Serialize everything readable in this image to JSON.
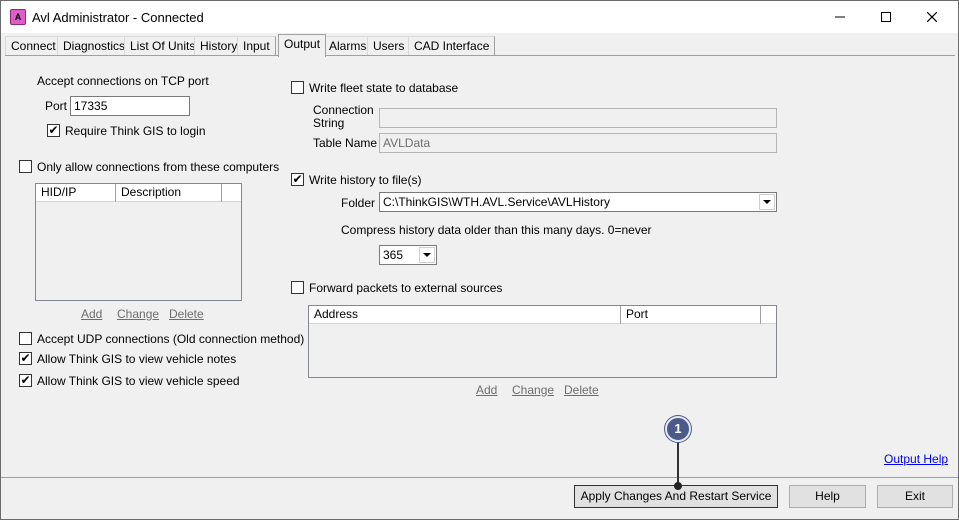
{
  "window": {
    "title": "Avl Administrator - Connected",
    "icon": "app-icon",
    "icon_text": "A"
  },
  "tabs": [
    {
      "label": "Connect"
    },
    {
      "label": "Diagnostics"
    },
    {
      "label": "List Of Units"
    },
    {
      "label": "History"
    },
    {
      "label": "Input"
    },
    {
      "label": "Output",
      "active": true
    },
    {
      "label": "Alarms"
    },
    {
      "label": "Users"
    },
    {
      "label": "CAD Interface"
    }
  ],
  "left": {
    "tcp_heading": "Accept connections on TCP port",
    "port_label": "Port",
    "port_value": "17335",
    "require_login_label": "Require Think GIS to login",
    "require_login_checked": true,
    "only_allow_label": "Only allow connections from these computers",
    "only_allow_checked": false,
    "columns": [
      "HID/IP",
      "Description"
    ],
    "add": "Add",
    "change": "Change",
    "delete": "Delete",
    "udp_label": "Accept UDP connections (Old connection method)",
    "udp_checked": false,
    "notes_label": "Allow Think GIS to view vehicle notes",
    "notes_checked": true,
    "speed_label": "Allow Think GIS to view vehicle speed",
    "speed_checked": true
  },
  "right": {
    "fleet_label": "Write fleet state to database",
    "fleet_checked": false,
    "conn_label_1": "Connection",
    "conn_label_2": "String",
    "conn_value": "",
    "table_label": "Table Name",
    "table_value": "AVLData",
    "history_label": "Write history to file(s)",
    "history_checked": true,
    "folder_label": "Folder",
    "folder_value": "C:\\ThinkGIS\\WTH.AVL.Service\\AVLHistory",
    "compress_label": "Compress history data older than this many days.  0=never",
    "compress_value": "365",
    "forward_label": "Forward packets to external sources",
    "forward_checked": false,
    "columns": [
      "Address",
      "Port"
    ],
    "add": "Add",
    "change": "Change",
    "delete": "Delete",
    "output_help": "Output Help"
  },
  "buttons": {
    "apply": "Apply Changes And Restart Service",
    "help": "Help",
    "exit": "Exit"
  },
  "callout": {
    "number": "1"
  }
}
